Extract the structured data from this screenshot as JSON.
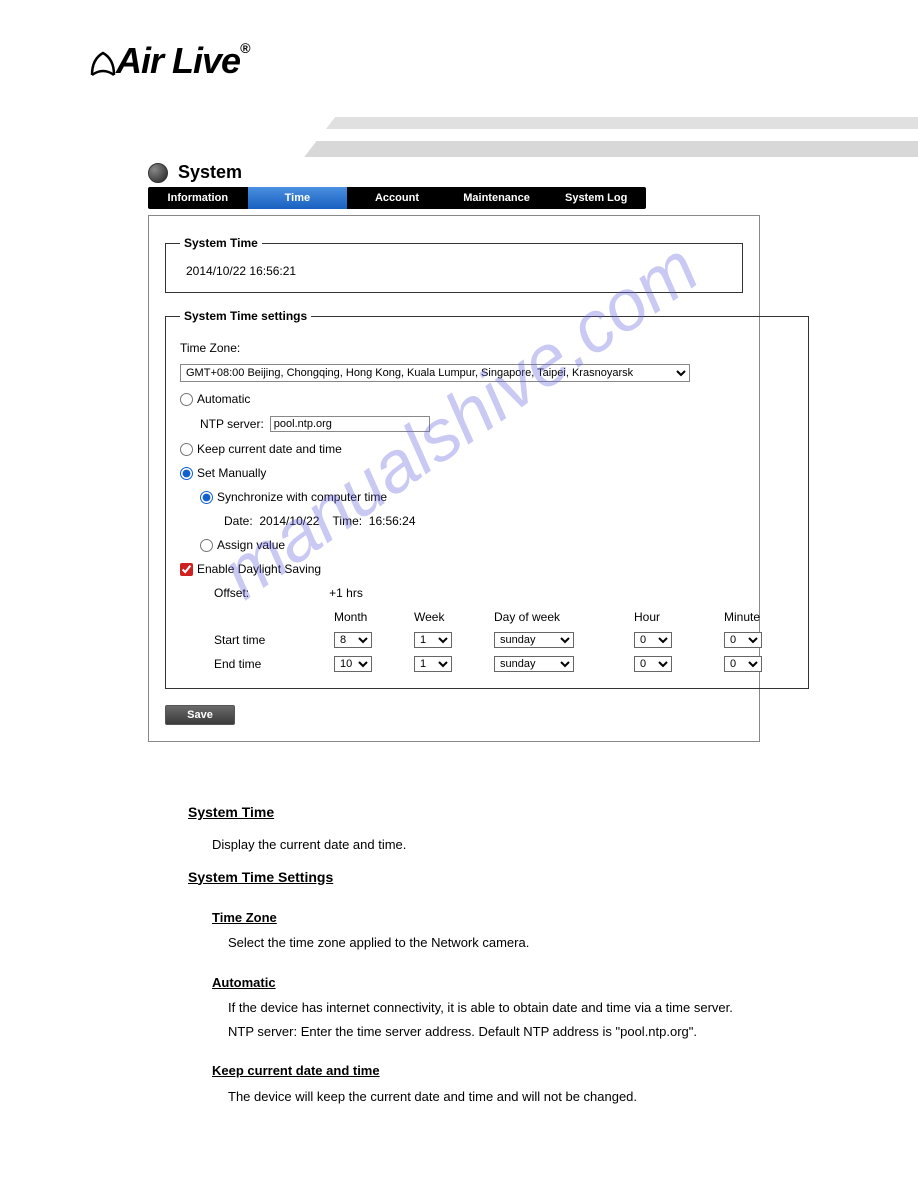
{
  "logo": {
    "text": "Air Live",
    "registered": "®"
  },
  "page": {
    "title": "System"
  },
  "tabs": [
    {
      "label": "Information"
    },
    {
      "label": "Time"
    },
    {
      "label": "Account"
    },
    {
      "label": "Maintenance"
    },
    {
      "label": "System Log"
    }
  ],
  "system_time": {
    "legend": "System Time",
    "value": "2014/10/22 16:56:21"
  },
  "settings": {
    "legend": "System Time settings",
    "tz_label": "Time Zone:",
    "tz_value": "GMT+08:00 Beijing, Chongqing, Hong Kong, Kuala Lumpur, Singapore, Taipei, Krasnoyarsk",
    "auto": {
      "label": "Automatic",
      "ntp_label": "NTP server:",
      "ntp_value": "pool.ntp.org"
    },
    "keep": {
      "label": "Keep current date and time"
    },
    "manual": {
      "label": "Set Manually",
      "sync": {
        "label": "Synchronize with computer time",
        "date_lbl": "Date:",
        "date_val": "2014/10/22",
        "time_lbl": "Time:",
        "time_val": "16:56:24"
      },
      "assign": {
        "label": "Assign value"
      }
    },
    "dst": {
      "label": "Enable Daylight Saving",
      "offset_lbl": "Offset:",
      "offset_val": "+1 hrs",
      "headers": {
        "month": "Month",
        "week": "Week",
        "dow": "Day of week",
        "hour": "Hour",
        "minute": "Minute"
      },
      "start": {
        "label": "Start time",
        "month": "8",
        "week": "1",
        "dow": "sunday",
        "hour": "0",
        "minute": "0"
      },
      "end": {
        "label": "End time",
        "month": "10",
        "week": "1",
        "dow": "sunday",
        "hour": "0",
        "minute": "0"
      }
    }
  },
  "save_label": "Save",
  "doc": {
    "h_system_time": "System Time",
    "p_system_time": "Display the current date and time.",
    "h_settings": "System Time Settings",
    "h_tz": "Time Zone",
    "p_tz": "Select the time zone applied to the Network camera.",
    "h_auto": "Automatic",
    "p_auto": "If the device has internet connectivity, it is able to obtain date and time via a time server.",
    "p_ntp": "NTP server: Enter the time server address. Default NTP address is \"pool.ntp.org\".",
    "h_keep": "Keep current date and time",
    "p_keep": "The device will keep the current date and time and will not be changed."
  },
  "watermark": "manualshive.com"
}
